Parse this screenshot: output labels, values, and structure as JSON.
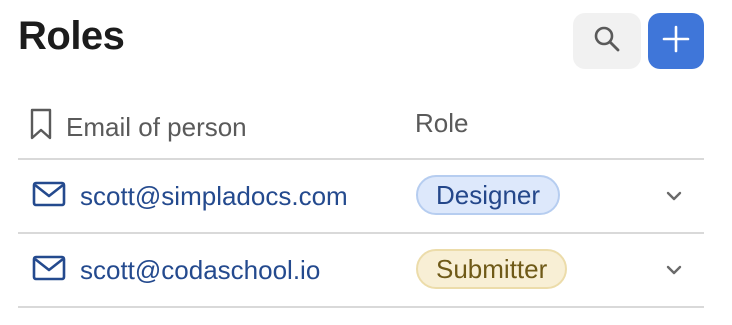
{
  "page": {
    "title": "Roles"
  },
  "toolbar": {
    "search_icon": "search-icon",
    "add_icon": "plus-icon",
    "add_color": "#3f76d9"
  },
  "table": {
    "columns": [
      {
        "label": "Email of person",
        "icon": "bookmark-icon"
      },
      {
        "label": "Role"
      }
    ],
    "rows": [
      {
        "email": "scott@simpladocs.com",
        "role": "Designer",
        "role_color": "#dde8fb"
      },
      {
        "email": "scott@codaschool.io",
        "role": "Submitter",
        "role_color": "#f8efd5"
      }
    ]
  }
}
